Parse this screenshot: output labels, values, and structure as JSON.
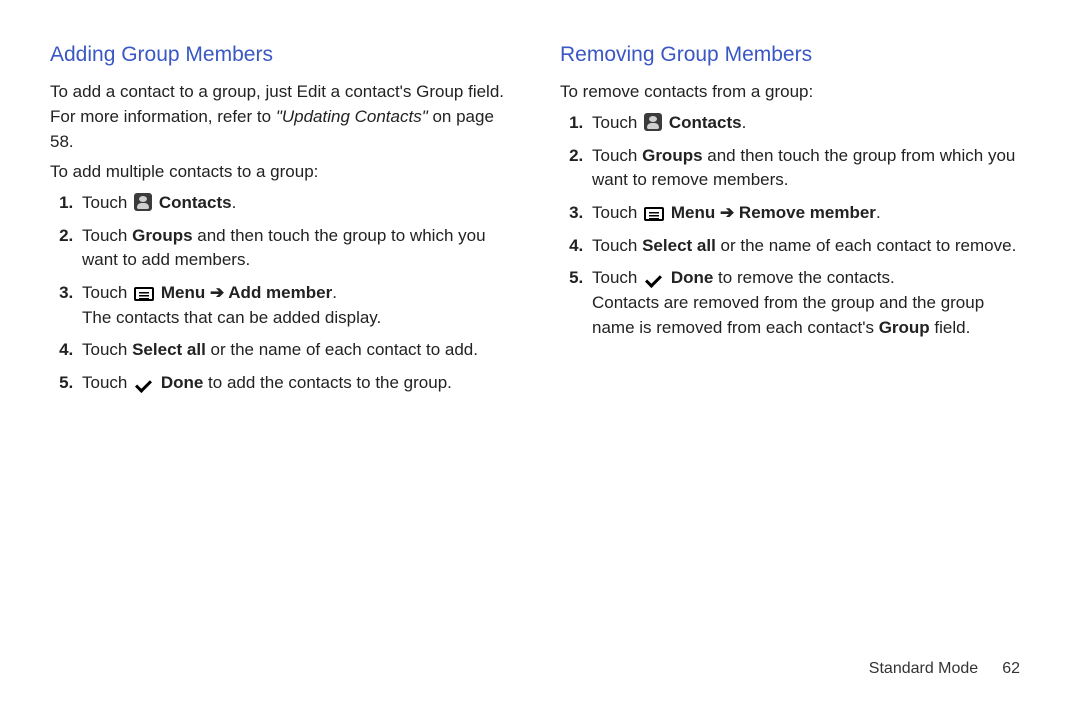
{
  "left": {
    "heading": "Adding Group Members",
    "intro1a": "To add a contact to a group, just Edit a contact's Group field. For more information, refer to ",
    "intro1b": "\"Updating Contacts\"",
    "intro1c": " on page 58.",
    "lead": "To add multiple contacts to a group:",
    "s1a": "Touch ",
    "s1b": "Contacts",
    "s1c": ".",
    "s2a": "Touch ",
    "s2b": "Groups",
    "s2c": " and then touch the group to which you want to add members.",
    "s3a": "Touch ",
    "s3b": "Menu",
    "s3arrow": " ➔ ",
    "s3c": "Add member",
    "s3d": ".",
    "s3note": "The contacts that can be added display.",
    "s4a": "Touch ",
    "s4b": "Select all",
    "s4c": " or the name of each contact to add.",
    "s5a": "Touch ",
    "s5b": "Done",
    "s5c": " to add the contacts to the group."
  },
  "right": {
    "heading": "Removing Group Members",
    "lead": "To remove contacts from a group:",
    "s1a": "Touch ",
    "s1b": "Contacts",
    "s1c": ".",
    "s2a": "Touch ",
    "s2b": "Groups",
    "s2c": " and then touch the group from which you want to remove members.",
    "s3a": "Touch ",
    "s3b": "Menu",
    "s3arrow": " ➔ ",
    "s3c": "Remove member",
    "s3d": ".",
    "s4a": "Touch ",
    "s4b": "Select all",
    "s4c": " or the name of each contact to remove.",
    "s5a": "Touch ",
    "s5b": "Done",
    "s5c": " to remove the contacts.",
    "s5note1": "Contacts are removed from the group and the group name is removed from each contact's ",
    "s5note2": "Group",
    "s5note3": " field."
  },
  "footer": {
    "mode": "Standard Mode",
    "page": "62"
  }
}
